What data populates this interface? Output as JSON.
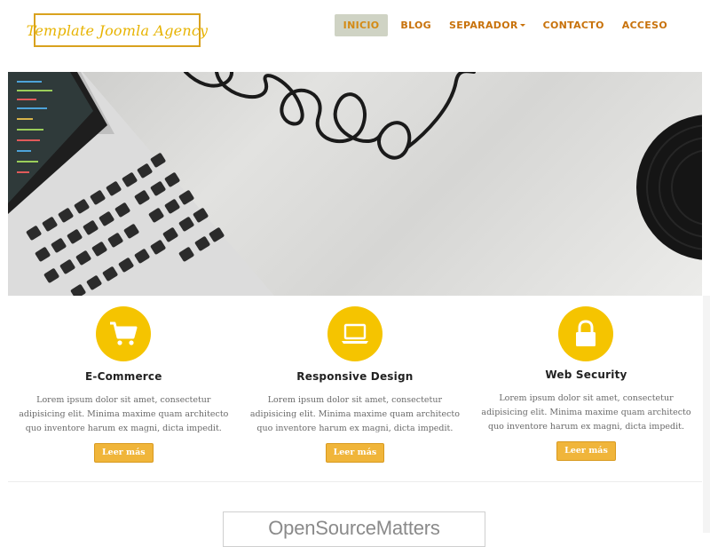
{
  "brand": {
    "logo_text": "Template Joomla Agency"
  },
  "nav": {
    "items": [
      {
        "label": "INICIO",
        "active": true
      },
      {
        "label": "BLOG",
        "active": false
      },
      {
        "label": "SEPARADOR",
        "active": false,
        "has_dropdown": true
      },
      {
        "label": "CONTACTO",
        "active": false
      },
      {
        "label": "ACCESO",
        "active": false
      }
    ]
  },
  "hero": {
    "image_name": "laptop-headphones-vinyl-desk"
  },
  "features": [
    {
      "icon": "shopping-cart-icon",
      "title": "E-Commerce",
      "text": "Lorem ipsum dolor sit amet, consectetur adipisicing elit. Minima maxime quam architecto quo inventore harum ex magni, dicta impedit.",
      "button": "Leer más"
    },
    {
      "icon": "laptop-icon",
      "title": "Responsive Design",
      "text": "Lorem ipsum dolor sit amet, consectetur adipisicing elit. Minima maxime quam architecto quo inventore harum ex magni, dicta impedit.",
      "button": "Leer más"
    },
    {
      "icon": "lock-icon",
      "title": "Web Security",
      "text": "Lorem ipsum dolor sit amet, consectetur adipisicing elit. Minima maxime quam architecto quo inventore harum ex magni, dicta impedit.",
      "button": "Leer más"
    }
  ],
  "footer": {
    "partner_logo": "OpenSourceMatters"
  },
  "colors": {
    "accent": "#f5c400",
    "nav_text": "#c8720b",
    "button": "#f0b53a"
  }
}
